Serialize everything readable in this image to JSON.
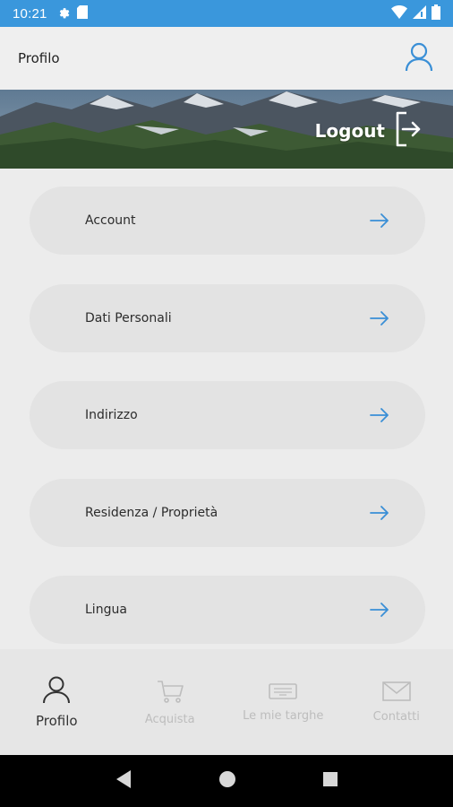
{
  "status_bar": {
    "time": "10:21",
    "left_icons": [
      "gear-icon",
      "sim-card-icon"
    ],
    "right_icons": [
      "wifi-icon",
      "signal-icon",
      "battery-icon"
    ],
    "bg_color": "#3a97dc"
  },
  "app_bar": {
    "title": "Profilo",
    "user_icon": "user-icon"
  },
  "hero": {
    "logout_label": "Logout",
    "logout_icon": "logout-icon"
  },
  "menu": {
    "items": [
      {
        "label": "Account",
        "icon": "arrow-right-icon"
      },
      {
        "label": "Dati Personali",
        "icon": "arrow-right-icon"
      },
      {
        "label": "Indirizzo",
        "icon": "arrow-right-icon"
      },
      {
        "label": "Residenza / Proprietà",
        "icon": "arrow-right-icon"
      },
      {
        "label": "Lingua",
        "icon": "arrow-right-icon"
      }
    ],
    "arrow_color": "#3a8fd6"
  },
  "bottom_nav": {
    "items": [
      {
        "label": "Profilo",
        "icon": "user-icon",
        "active": true
      },
      {
        "label": "Acquista",
        "icon": "cart-icon",
        "active": false
      },
      {
        "label": "Le mie targhe",
        "icon": "license-plate-icon",
        "active": false
      },
      {
        "label": "Contatti",
        "icon": "mail-icon",
        "active": false
      }
    ]
  },
  "system_nav": [
    "back-icon",
    "home-icon",
    "recents-icon"
  ]
}
